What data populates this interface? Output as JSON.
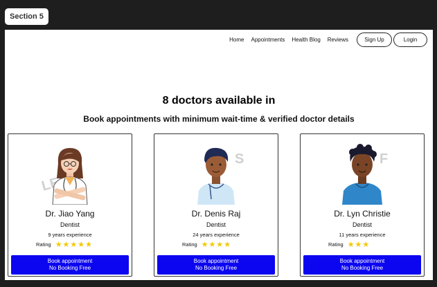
{
  "section_tag": "Section 5",
  "nav": {
    "links": [
      "Home",
      "Appointments",
      "Health Blog",
      "Reviews"
    ],
    "signup_label": "Sign Up",
    "login_label": "Login"
  },
  "headline": "8 doctors available in",
  "subline": "Book appointments with minimum wait-time & verified doctor details",
  "rating_label": "Rating",
  "colors": {
    "accent": "#0c06f0",
    "star": "#f2c800"
  },
  "doctors": [
    {
      "name": "Dr. Jiao Yang",
      "specialty": "Dentist",
      "experience": "9 years experience",
      "rating": 5,
      "stars": "★★★★★",
      "book_label": "Book appointment",
      "book_sub": "No Booking Free",
      "watermark": "LE"
    },
    {
      "name": "Dr. Denis Raj",
      "specialty": "Dentist",
      "experience": "24 years experience",
      "rating": 4,
      "stars": "★★★★",
      "book_label": "Book appointment",
      "book_sub": "No Booking Free",
      "watermark": "S"
    },
    {
      "name": "Dr. Lyn Christie",
      "specialty": "Dentist",
      "experience": "11 years experience",
      "rating": 3,
      "stars": "★★★",
      "book_label": "Book appointment",
      "book_sub": "No Booking Free",
      "watermark": "F"
    }
  ]
}
